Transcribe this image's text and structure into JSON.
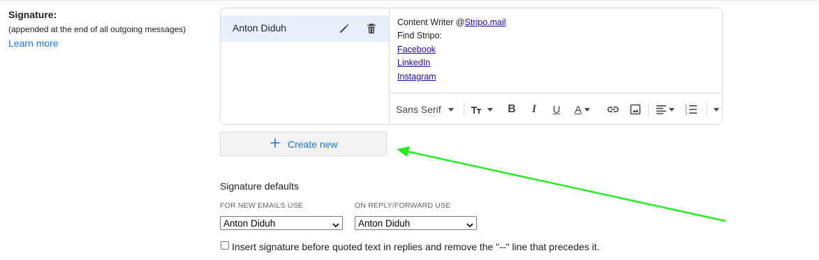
{
  "signature_section": {
    "label": "Signature:",
    "sublabel": "(appended at the end of all outgoing messages)",
    "learn_more": "Learn more"
  },
  "signatures": [
    {
      "name": "Anton Diduh",
      "selected": true
    }
  ],
  "editor": {
    "line1_prefix": "Content Writer @",
    "line1_link": "Stripo.mail",
    "line2": "Find Stripo:",
    "links": [
      "Facebook",
      "LinkedIn",
      "Instagram"
    ]
  },
  "toolbar": {
    "font": "Sans Serif",
    "icons": [
      "text-size-icon",
      "bold-icon",
      "italic-icon",
      "underline-icon",
      "text-color-icon",
      "link-icon",
      "image-icon",
      "align-icon",
      "numbered-list-icon",
      "more-formatting-icon"
    ]
  },
  "create_new": {
    "label": "Create new"
  },
  "defaults": {
    "title": "Signature defaults",
    "new_emails_label": "FOR NEW EMAILS USE",
    "new_emails_value": "Anton Diduh",
    "reply_label": "ON REPLY/FORWARD USE",
    "reply_value": "Anton Diduh"
  },
  "checkbox": {
    "label": "Insert signature before quoted text in replies and remove the \"--\" line that precedes it.",
    "checked": false
  },
  "colors": {
    "accent": "#1a73e8",
    "selected_row": "#e8f0fe",
    "annotation_arrow": "#22ee22"
  }
}
